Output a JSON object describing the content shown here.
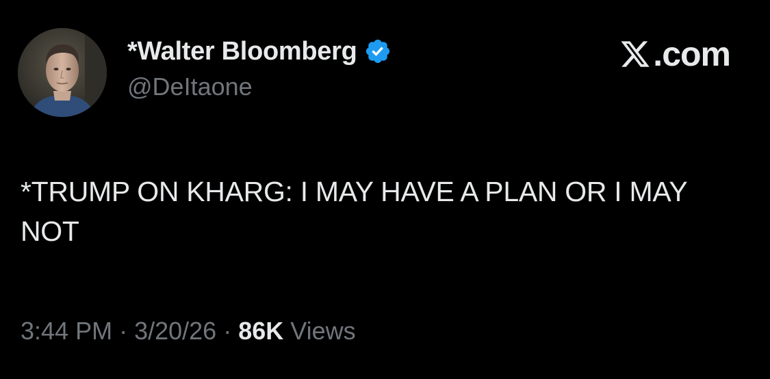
{
  "author": {
    "display_name": "*Walter Bloomberg",
    "handle": "@DeItaone",
    "verified": true,
    "verified_color": "#1d9bf0",
    "avatar_icon": "profile-photo"
  },
  "brand": {
    "domain_text": ".com",
    "logo_icon": "x-logo-icon"
  },
  "tweet": {
    "text": "*TRUMP ON KHARG: I MAY HAVE A PLAN OR I MAY NOT"
  },
  "meta": {
    "time": "3:44 PM",
    "separator": "·",
    "date": "3/20/26",
    "views_count": "86K",
    "views_label": "Views"
  },
  "colors": {
    "background": "#000000",
    "text_primary": "#e7e9ea",
    "text_secondary": "#71767b"
  }
}
